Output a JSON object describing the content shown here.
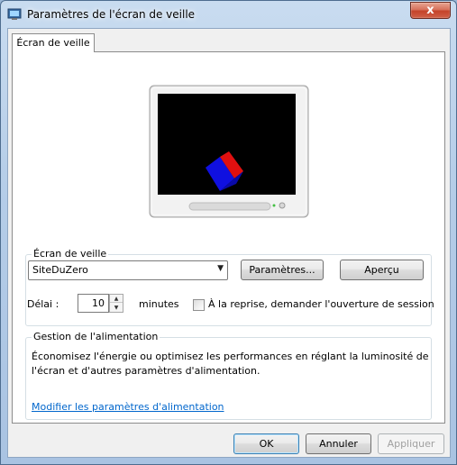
{
  "window": {
    "title": "Paramètres de l'écran de veille",
    "close_label": "x"
  },
  "tab": {
    "label": "Écran de veille"
  },
  "screensaver_group": {
    "label": "Écran de veille",
    "selected": "SiteDuZero",
    "settings_button": "Paramètres...",
    "preview_button": "Aperçu",
    "delay_label": "Délai :",
    "delay_value": "10",
    "minutes_label": "minutes",
    "resume_label": "À la reprise, demander l'ouverture de session",
    "resume_checked": false
  },
  "power_group": {
    "label": "Gestion de l'alimentation",
    "description_line1": "Économisez l'énergie ou optimisez les performances en réglant la luminosité de",
    "description_line2": "l'écran et d'autres paramètres d'alimentation.",
    "link": "Modifier les paramètres d'alimentation"
  },
  "footer": {
    "ok": "OK",
    "cancel": "Annuler",
    "apply": "Appliquer"
  },
  "icons": {
    "app": "display-settings-icon",
    "cube": "cube-icon"
  },
  "colors": {
    "accent_link": "#0066cc",
    "cube_red": "#e01010",
    "cube_blue": "#1010e0"
  }
}
